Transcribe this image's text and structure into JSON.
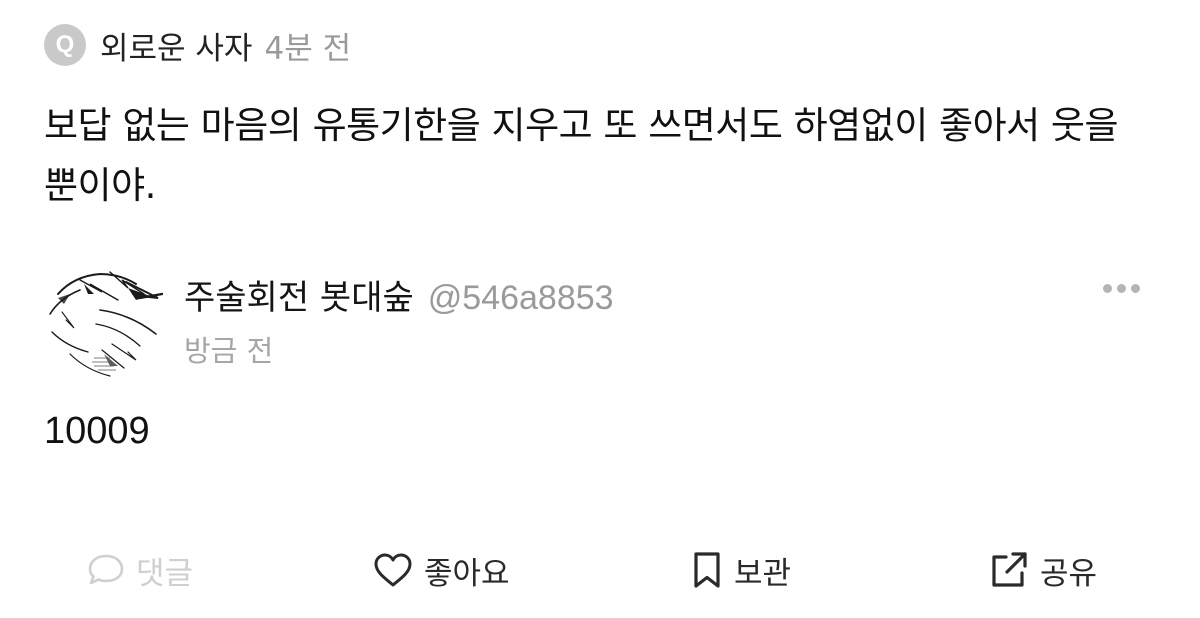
{
  "question": {
    "badge": "Q",
    "author": "외로운 사자",
    "time": "4분 전",
    "text": "보답 없는 마음의 유통기한을 지우고 또 쓰면서도 하염없이 좋아서 웃을 뿐이야."
  },
  "answer": {
    "author_name": "주술회전 봇대숲",
    "handle": "@546a8853",
    "time": "방금 전",
    "text": "10009",
    "avatar_icon": "sketch-avatar-icon",
    "more_icon": "more-dots-icon"
  },
  "actions": {
    "comment": {
      "label": "댓글",
      "icon": "speech-bubble-icon",
      "color": "#cfcfcf"
    },
    "like": {
      "label": "좋아요",
      "icon": "heart-icon"
    },
    "save": {
      "label": "보관",
      "icon": "bookmark-icon"
    },
    "share": {
      "label": "공유",
      "icon": "share-arrow-icon"
    }
  },
  "colors": {
    "text_primary": "#111111",
    "text_muted": "#9a9a9a",
    "badge_bg": "#c9c9c9"
  }
}
